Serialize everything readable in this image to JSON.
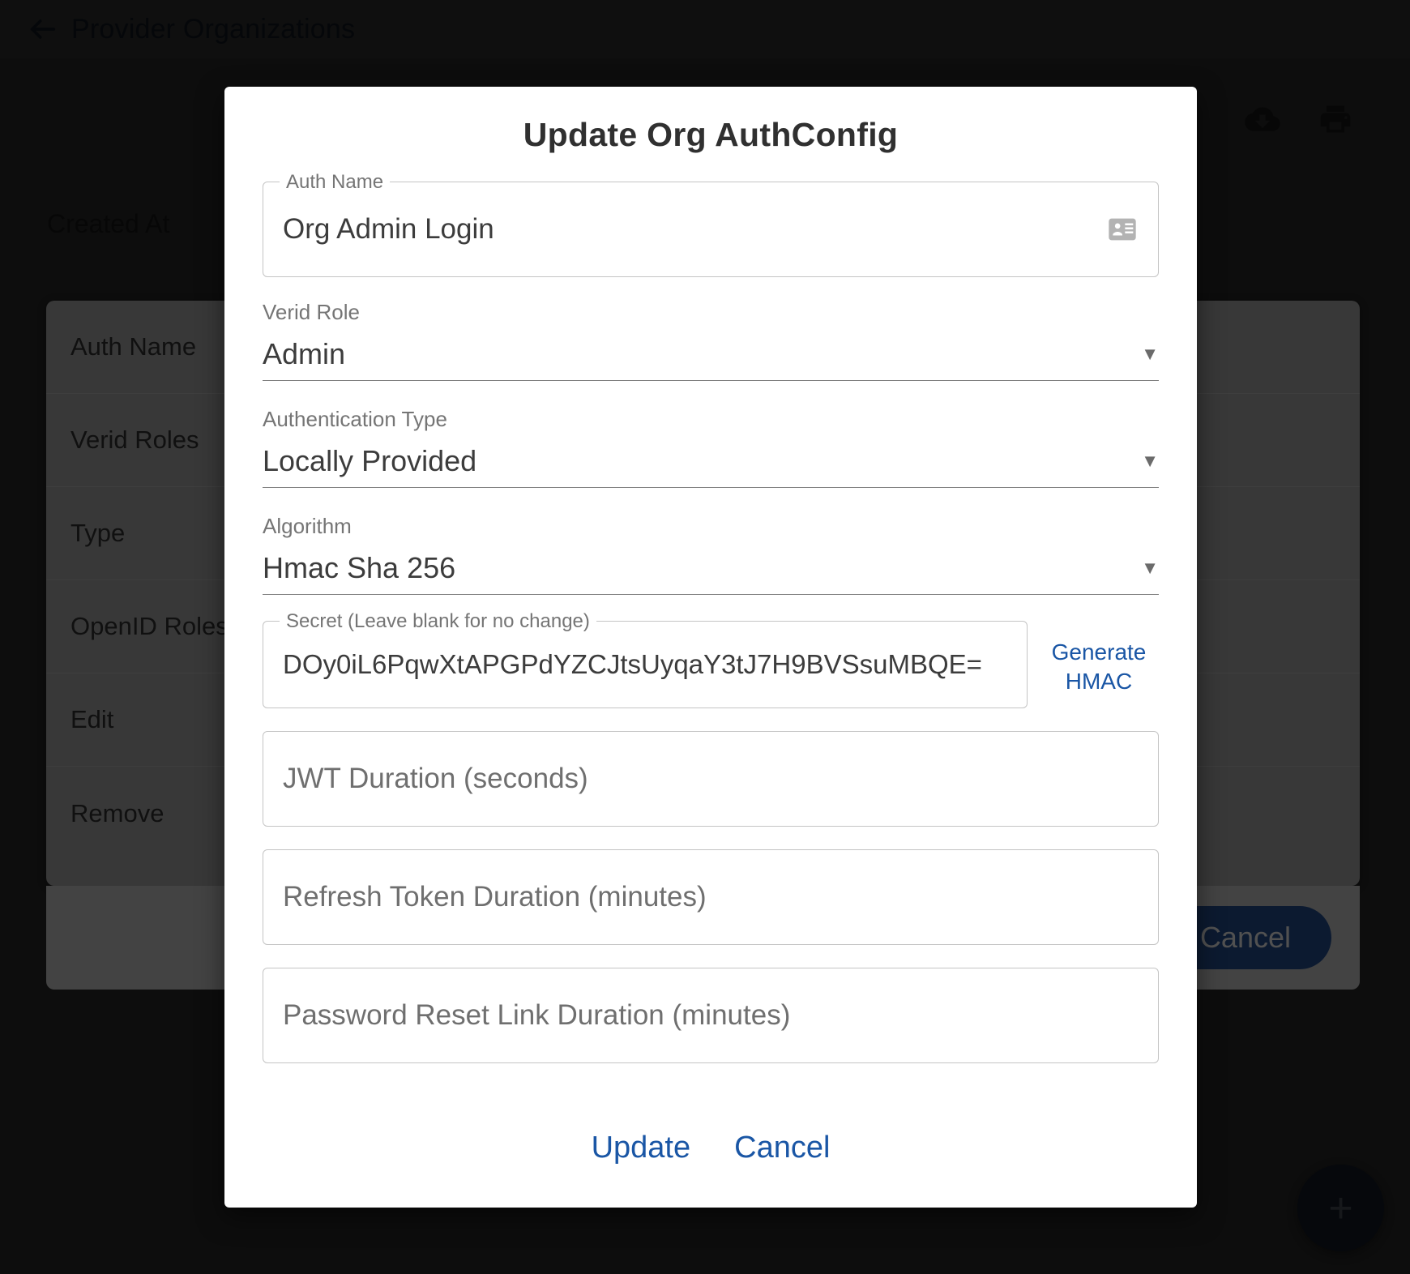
{
  "background": {
    "page_title": "Provider Organizations",
    "back_icon": "arrow-left-icon",
    "toolbar_icons": [
      "cloud-download-icon",
      "print-icon"
    ],
    "column_heading": "Created At",
    "table_rows": [
      "Auth Name",
      "Verid Roles",
      "Type",
      "OpenID Roles",
      "Edit",
      "Remove"
    ],
    "cancel_label": "Cancel",
    "fab_label": "+",
    "fab_icon": "plus-icon"
  },
  "dialog": {
    "title": "Update Org AuthConfig",
    "auth_name": {
      "legend": "Auth Name",
      "value": "Org Admin Login",
      "trailing_icon": "contact-card-icon"
    },
    "verid_role": {
      "label": "Verid Role",
      "value": "Admin",
      "caret_icon": "chevron-down-icon"
    },
    "authentication_type": {
      "label": "Authentication Type",
      "value": "Locally Provided",
      "caret_icon": "chevron-down-icon"
    },
    "algorithm": {
      "label": "Algorithm",
      "value": "Hmac Sha 256",
      "caret_icon": "chevron-down-icon"
    },
    "secret": {
      "legend": "Secret (Leave blank for no change)",
      "value": "DOy0iL6PqwXtAPGPdYZCJtsUyqaY3tJ7H9BVSsuMBQE=",
      "generate_label": "Generate HMAC"
    },
    "jwt_duration": {
      "placeholder": "JWT Duration (seconds)",
      "value": ""
    },
    "refresh_token_duration": {
      "placeholder": "Refresh Token Duration (minutes)",
      "value": ""
    },
    "password_reset_duration": {
      "placeholder": "Password Reset Link Duration (minutes)",
      "value": ""
    },
    "update_label": "Update",
    "cancel_label": "Cancel"
  },
  "colors": {
    "link_blue": "#1a56a5",
    "dialog_bg": "#ffffff",
    "page_bg": "#1e1e1e",
    "cancel_button_bg": "#1d3c6e"
  }
}
